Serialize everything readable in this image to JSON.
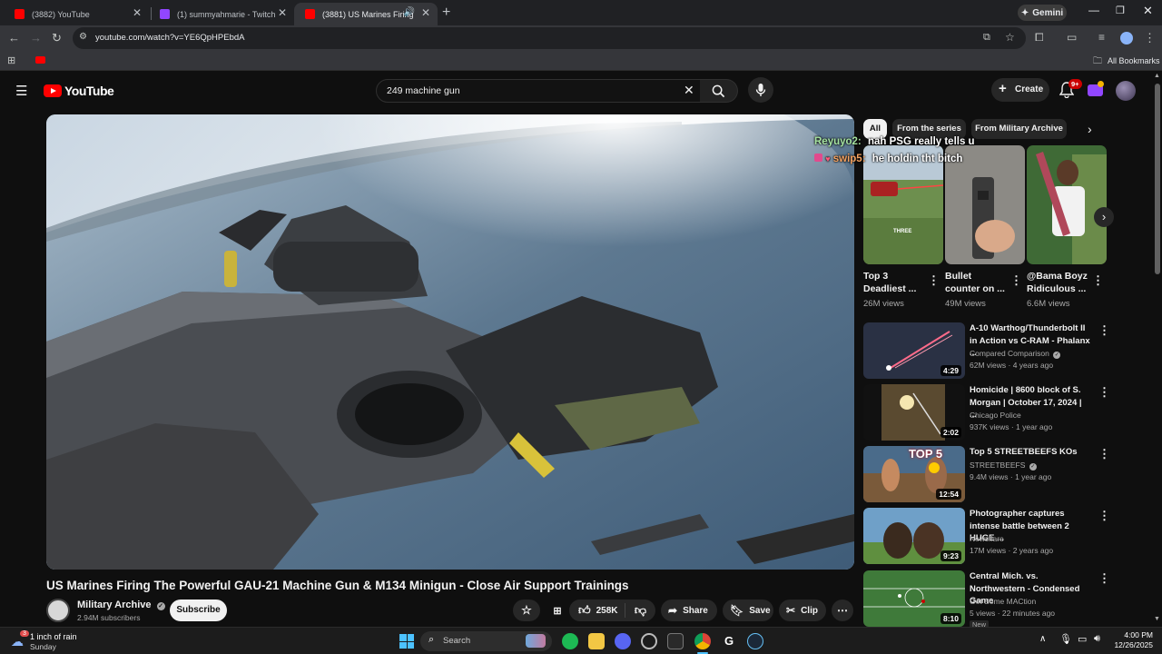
{
  "browser": {
    "tabs": [
      {
        "title": "(3882) YouTube",
        "favicon_color": "#ff0000"
      },
      {
        "title": "(1) summyahmarie - Twitch",
        "favicon_color": "#9146ff"
      },
      {
        "title": "(3881) US Marines Firing Th",
        "favicon_color": "#ff0000"
      }
    ],
    "gemini_label": "Gemini",
    "url": "youtube.com/watch?v=YE6QpHPEbdA",
    "bookmarks_label": "All Bookmarks"
  },
  "youtube": {
    "logo_text": "YouTube",
    "search_query": "249 machine gun",
    "create_label": "Create",
    "notif_badge": "9+"
  },
  "video": {
    "title": "US Marines Firing The Powerful GAU-21 Machine Gun & M134 Minigun - Close Air Support Trainings",
    "channel": "Military Archive",
    "subscribers": "2.94M subscribers",
    "subscribe_label": "Subscribe",
    "likes": "258K",
    "share_label": "Share",
    "save_label": "Save",
    "clip_label": "Clip"
  },
  "chips": [
    "All",
    "From the series",
    "From Military Archive"
  ],
  "chat": [
    {
      "user": "Reyuyo2:",
      "message": "nah PSG really tells u",
      "user_color": "#a6e3a1"
    },
    {
      "user": "swip5:",
      "message": "he holdin tht bitch",
      "user_color": "#f4a261"
    }
  ],
  "shorts": [
    {
      "title": "Top 3 Deadliest ...",
      "views": "26M views",
      "overlay": "THREE"
    },
    {
      "title": "Bullet counter on ...",
      "views": "49M views"
    },
    {
      "title": "@Bama Boyz Ridiculous ...",
      "views": "6.6M views"
    }
  ],
  "recommendations": [
    {
      "title": "A-10 Warthog/Thunderbolt II in Action vs C-RAM - Phalanx ...",
      "channel": "Compared Comparison",
      "verified": true,
      "meta": "62M views · 4 years ago",
      "duration": "4:29"
    },
    {
      "title": "Homicide | 8600 block of S. Morgan | October 17, 2024 | ...",
      "channel": "Chicago Police",
      "verified": false,
      "meta": "937K views · 1 year ago",
      "duration": "2:02"
    },
    {
      "title": "Top 5 STREETBEEFS KOs",
      "channel": "STREETBEEFS",
      "verified": true,
      "meta": "9.4M views · 1 year ago",
      "duration": "12:54",
      "overlay": "TOP 5"
    },
    {
      "title": "Photographer captures intense battle between 2 HUGE ...",
      "channel": "Newsflare",
      "verified": false,
      "meta": "17M views · 2 years ago",
      "duration": "9:23"
    },
    {
      "title": "Central Mich. vs. Northwestern - Condensed Game",
      "channel": "Get Some MACtion",
      "verified": false,
      "meta": "5 views · 22 minutes ago",
      "duration": "8:10",
      "badge": "New"
    }
  ],
  "taskbar": {
    "weather_temp_badge": "3",
    "weather_text": "1 inch of rain",
    "weather_day": "Sunday",
    "search_label": "Search",
    "time": "4:00 PM",
    "date": "12/26/2025"
  }
}
